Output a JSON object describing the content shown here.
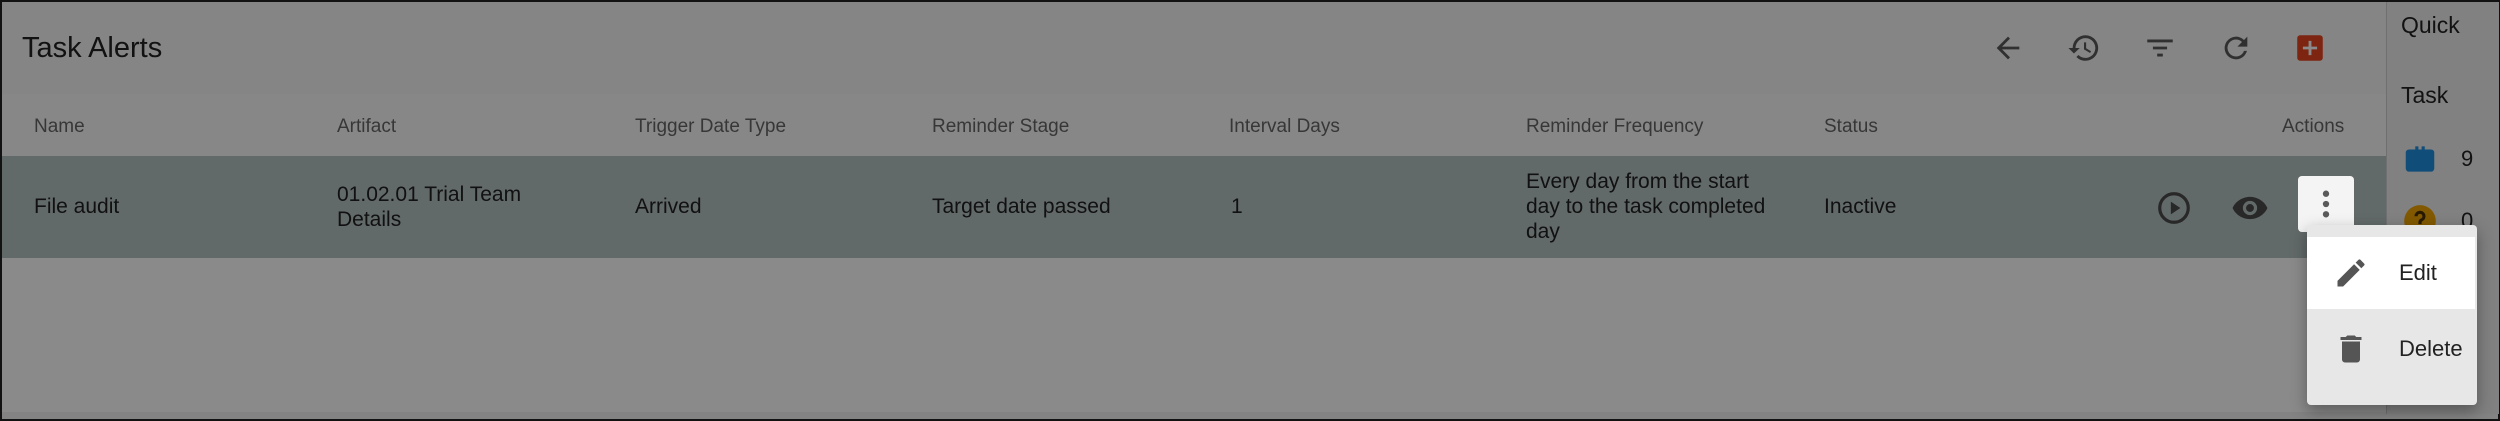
{
  "page": {
    "title": "Task Alerts"
  },
  "toolbar": {
    "icons": [
      "back-arrow-icon",
      "history-icon",
      "filter-icon",
      "refresh-icon",
      "add-icon"
    ],
    "accent_color": "#e8451e"
  },
  "table": {
    "columns": [
      "Name",
      "Artifact",
      "Trigger Date Type",
      "Reminder Stage",
      "Interval Days",
      "Reminder Frequency",
      "Status",
      "Actions"
    ],
    "rows": [
      {
        "name": "File audit",
        "artifact_line1": "01.02.01 Trial Team",
        "artifact_line2": "Details",
        "trigger_date_type": "Arrived",
        "reminder_stage": "Target date passed",
        "interval_days": "1",
        "freq_line1": "Every day from the start",
        "freq_line2": "day to the task completed",
        "freq_line3": "day",
        "status": "Inactive"
      }
    ]
  },
  "quick_panel": {
    "title": "Quick",
    "section": "Task",
    "items": [
      {
        "icon": "briefcase-icon",
        "count": "9",
        "color": "#1f8fe0"
      },
      {
        "icon": "help-circle-icon",
        "count": "0",
        "color": "#f0a500"
      }
    ]
  },
  "row_menu": {
    "items": [
      {
        "icon": "pencil-icon",
        "label": "Edit"
      },
      {
        "icon": "trash-icon",
        "label": "Delete"
      }
    ]
  }
}
